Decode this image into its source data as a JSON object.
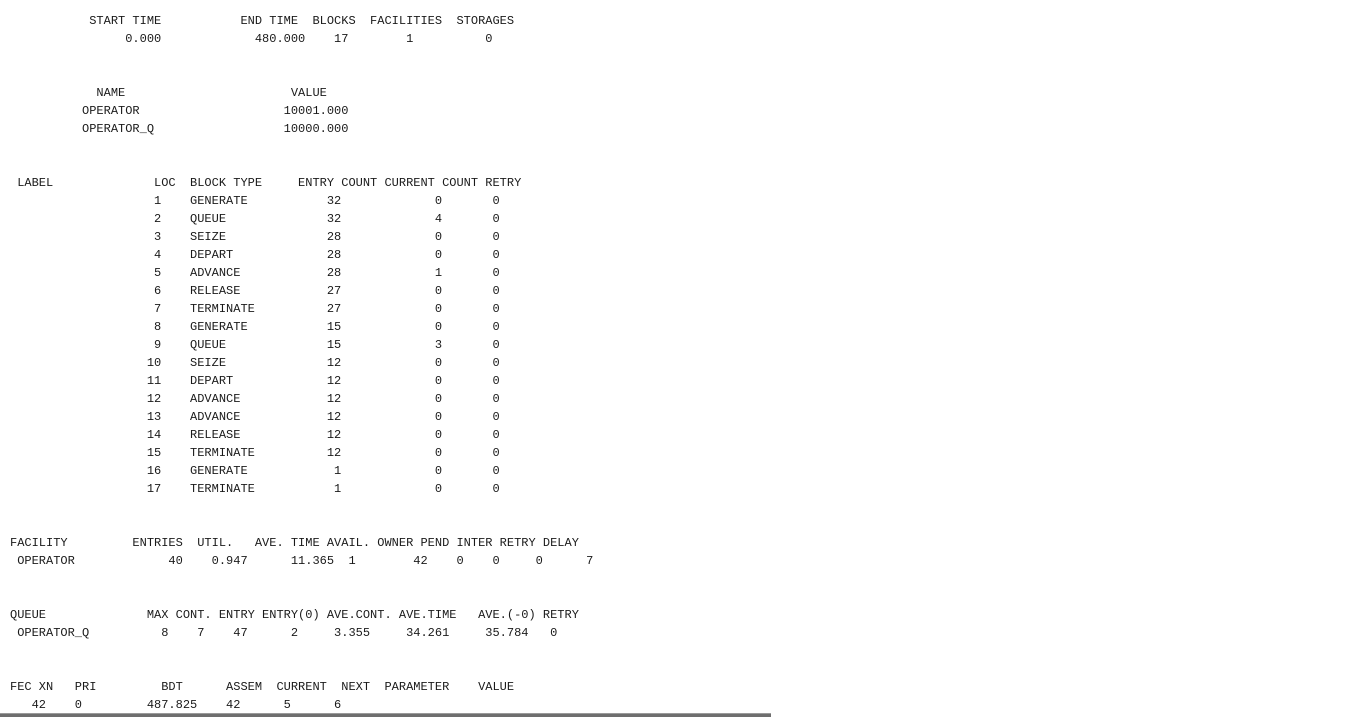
{
  "report": {
    "header": {
      "labels": "           START TIME           END TIME  BLOCKS  FACILITIES  STORAGES",
      "values": "                0.000             480.000    17        1          0"
    },
    "names": {
      "header": "            NAME                       VALUE",
      "rows": [
        "          OPERATOR                    10001.000",
        "          OPERATOR_Q                  10000.000"
      ]
    },
    "blocks": {
      "header": " LABEL              LOC  BLOCK TYPE     ENTRY COUNT CURRENT COUNT RETRY",
      "rows": [
        "                    1    GENERATE           32             0       0",
        "                    2    QUEUE              32             4       0",
        "                    3    SEIZE              28             0       0",
        "                    4    DEPART             28             0       0",
        "                    5    ADVANCE            28             1       0",
        "                    6    RELEASE            27             0       0",
        "                    7    TERMINATE          27             0       0",
        "                    8    GENERATE           15             0       0",
        "                    9    QUEUE              15             3       0",
        "                   10    SEIZE              12             0       0",
        "                   11    DEPART             12             0       0",
        "                   12    ADVANCE            12             0       0",
        "                   13    ADVANCE            12             0       0",
        "                   14    RELEASE            12             0       0",
        "                   15    TERMINATE          12             0       0",
        "                   16    GENERATE            1             0       0",
        "                   17    TERMINATE           1             0       0"
      ]
    },
    "facility": {
      "header": "FACILITY         ENTRIES  UTIL.   AVE. TIME AVAIL. OWNER PEND INTER RETRY DELAY",
      "row": " OPERATOR             40    0.947      11.365  1        42    0    0     0      7"
    },
    "queue": {
      "header": "QUEUE              MAX CONT. ENTRY ENTRY(0) AVE.CONT. AVE.TIME   AVE.(-0) RETRY",
      "row": " OPERATOR_Q          8    7    47      2     3.355     34.261     35.784   0"
    },
    "fec": {
      "header": "FEC XN   PRI         BDT      ASSEM  CURRENT  NEXT  PARAMETER    VALUE",
      "row": "   42    0         487.825    42      5      6"
    }
  }
}
